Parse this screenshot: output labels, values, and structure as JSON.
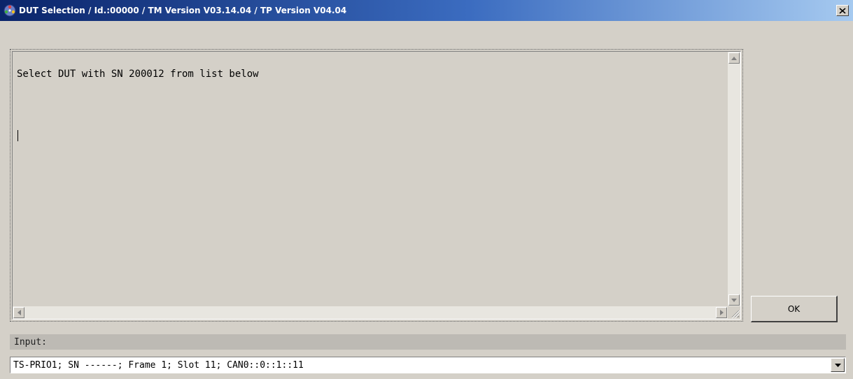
{
  "window": {
    "title": "DUT Selection / Id.:00000 / TM Version V03.14.04 / TP Version V04.04",
    "icons": {
      "app": "app-logo-icon",
      "close": "close-icon"
    }
  },
  "output": {
    "text": "Select DUT with SN 200012 from list below",
    "icons": {
      "scroll_up": "arrow-up-icon",
      "scroll_down": "arrow-down-icon",
      "scroll_left": "arrow-left-icon",
      "scroll_right": "arrow-right-icon",
      "resize": "resize-grip-icon"
    }
  },
  "ok_button": {
    "label": "OK"
  },
  "input": {
    "label": "Input:",
    "selected_value": "TS-PRIO1; SN ------; Frame 1; Slot 11; CAN0::0::1::11",
    "dropdown_icon": "chevron-down-icon"
  },
  "colors": {
    "titlebar_start": "#0a246a",
    "titlebar_end": "#a6caf0",
    "face": "#d4d0c8"
  }
}
